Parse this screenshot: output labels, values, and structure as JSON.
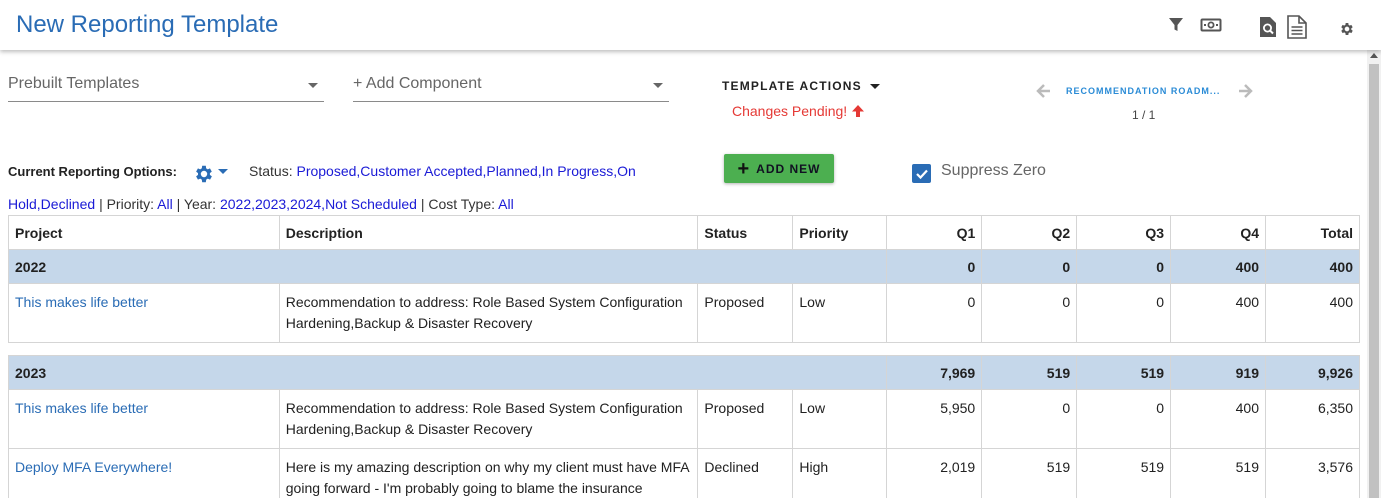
{
  "header": {
    "title": "New Reporting Template"
  },
  "toolbar": {
    "prebuilt_placeholder": "Prebuilt Templates",
    "add_component_placeholder": "+ Add Component",
    "template_actions": "TEMPLATE ACTIONS",
    "changes_pending": "Changes Pending!",
    "roadmap_label": "RECOMMENDATION ROADM...",
    "pager": "1 / 1"
  },
  "options": {
    "label": "Current Reporting Options:",
    "status_label": "Status:",
    "status_value_1": "Proposed,Customer Accepted,Planned,In Progress,On",
    "status_value_2": "Hold,Declined",
    "sep1": "| Priority:",
    "priority_value": "All",
    "sep2": "| Year:",
    "year_value": "2022,2023,2024,Not Scheduled",
    "sep3": "| Cost Type:",
    "cost_type_value": "All",
    "add_new": "ADD NEW",
    "suppress_zero": "Suppress Zero"
  },
  "table": {
    "columns": [
      "Project",
      "Description",
      "Status",
      "Priority",
      "Q1",
      "Q2",
      "Q3",
      "Q4",
      "Total"
    ],
    "groups": [
      {
        "year": "2022",
        "totals": [
          "0",
          "0",
          "0",
          "400",
          "400"
        ],
        "rows": [
          {
            "project": "This makes life better",
            "description": "Recommendation to address: Role Based System Configuration Hardening,Backup & Disaster Recovery",
            "status": "Proposed",
            "priority": "Low",
            "q1": "0",
            "q2": "0",
            "q3": "0",
            "q4": "400",
            "total": "400"
          }
        ]
      },
      {
        "year": "2023",
        "totals": [
          "7,969",
          "519",
          "519",
          "919",
          "9,926"
        ],
        "rows": [
          {
            "project": "This makes life better",
            "description": "Recommendation to address: Role Based System Configuration Hardening,Backup & Disaster Recovery",
            "status": "Proposed",
            "priority": "Low",
            "q1": "5,950",
            "q2": "0",
            "q3": "0",
            "q4": "400",
            "total": "6,350"
          },
          {
            "project": "Deploy MFA Everywhere!",
            "description": "Here is my amazing description on why my client must have MFA going forward - I'm probably going to blame the insurance",
            "status": "Declined",
            "priority": "High",
            "q1": "2,019",
            "q2": "519",
            "q3": "519",
            "q4": "519",
            "total": "3,576"
          }
        ]
      }
    ]
  },
  "colors": {
    "accent": "#2a6cb5",
    "pending": "#e53935",
    "add_button": "#4caf50",
    "group_row": "#c5d7ea",
    "option_value": "#1a1ad6"
  },
  "icons": [
    "filter-icon",
    "money-icon",
    "preview-icon",
    "document-icon",
    "settings-icon",
    "gear-icon",
    "arrow-up-icon",
    "chevron-left-icon",
    "chevron-right-icon",
    "checkbox-checked-icon",
    "plus-icon"
  ]
}
